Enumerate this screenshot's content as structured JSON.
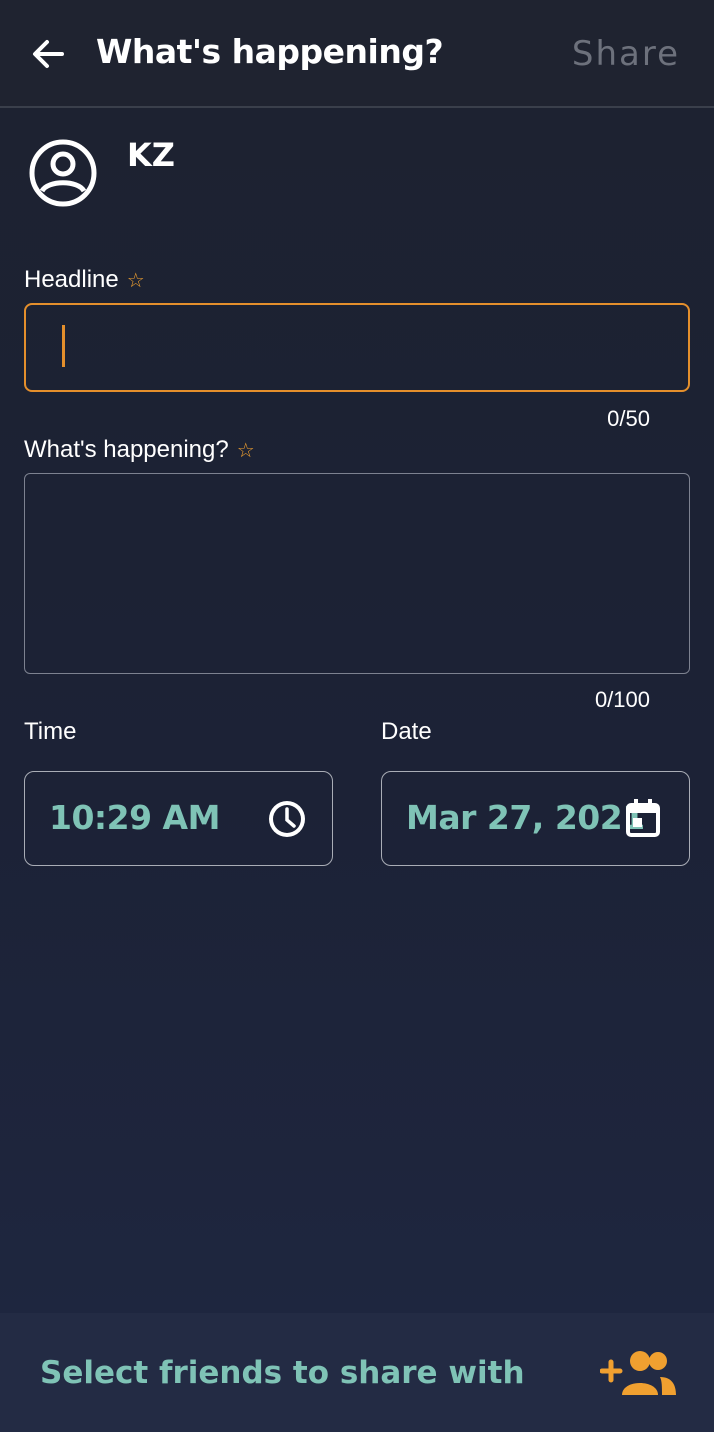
{
  "header": {
    "title": "What's happening?",
    "share_label": "Share"
  },
  "user": {
    "name": "KZ"
  },
  "form": {
    "headline": {
      "label": "Headline",
      "value": "",
      "counter": "0/50"
    },
    "body": {
      "label": "What's happening?",
      "value": "",
      "counter": "0/100"
    },
    "time": {
      "label": "Time",
      "value": "10:29 AM"
    },
    "date": {
      "label": "Date",
      "value": "Mar 27, 2021"
    }
  },
  "footer": {
    "select_friends_label": "Select friends to share with"
  },
  "icons": {
    "back": "arrow-left-icon",
    "avatar": "account-circle-icon",
    "required": "star-outline-icon",
    "time": "clock-icon",
    "date": "calendar-icon",
    "add_friends": "group-add-icon"
  },
  "colors": {
    "accent": "#e48f2c",
    "teal": "#7fc3b6",
    "muted": "#6d717c",
    "background": "#1d2230"
  }
}
